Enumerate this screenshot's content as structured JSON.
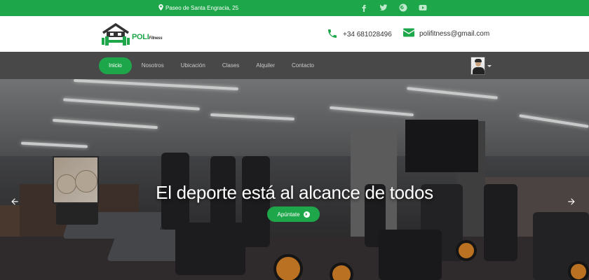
{
  "topbar": {
    "address": "Paseo de Santa Engracia, 25",
    "address_icon": "map-pin-icon",
    "socials": [
      "facebook-icon",
      "twitter-icon",
      "google-plus-icon",
      "youtube-icon"
    ],
    "color": "#1ea64a"
  },
  "header": {
    "logo_main": "POLI",
    "logo_sub": "Fitness",
    "phone": "+34 681028496",
    "email": "polifitness@gmail.com"
  },
  "nav": {
    "items": [
      {
        "label": "Inicio",
        "active": true
      },
      {
        "label": "Nosotros",
        "active": false
      },
      {
        "label": "Ubicación",
        "active": false
      },
      {
        "label": "Clases",
        "active": false
      },
      {
        "label": "Alquiler",
        "active": false
      },
      {
        "label": "Contacto",
        "active": false
      }
    ],
    "background": "#484848"
  },
  "hero": {
    "title": "El deporte está al alcance de todos",
    "cta_label": "Apúntate",
    "prev_icon": "arrow-left-icon",
    "next_icon": "arrow-right-icon"
  }
}
